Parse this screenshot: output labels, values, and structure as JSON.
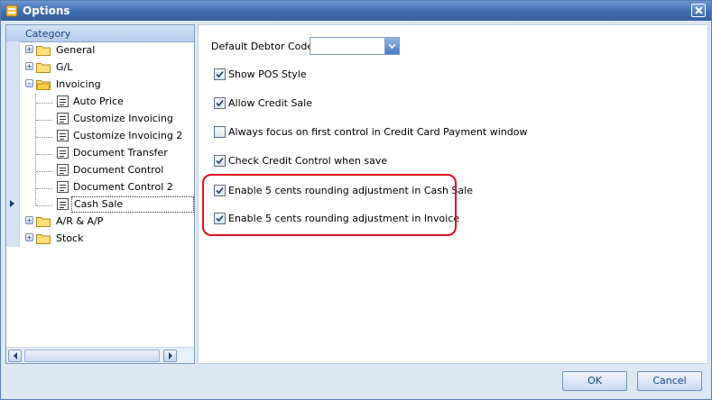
{
  "window": {
    "title": "Options"
  },
  "tree": {
    "header": "Category",
    "items": [
      {
        "label": "General",
        "type": "folder",
        "expander": "+"
      },
      {
        "label": "G/L",
        "type": "folder",
        "expander": "+"
      },
      {
        "label": "Invoicing",
        "type": "folder",
        "expander": "-"
      },
      {
        "label": "Auto Price",
        "type": "doc"
      },
      {
        "label": "Customize Invoicing",
        "type": "doc"
      },
      {
        "label": "Customize Invoicing 2",
        "type": "doc"
      },
      {
        "label": "Document Transfer",
        "type": "doc"
      },
      {
        "label": "Document Control",
        "type": "doc"
      },
      {
        "label": "Document Control 2",
        "type": "doc"
      },
      {
        "label": "Cash Sale",
        "type": "doc",
        "selected": true
      },
      {
        "label": "A/R & A/P",
        "type": "folder",
        "expander": "+"
      },
      {
        "label": "Stock",
        "type": "folder",
        "expander": "+"
      }
    ]
  },
  "settings": {
    "debtor_code_label": "Default Debtor Code:",
    "debtor_code_value": "",
    "checkboxes": [
      {
        "label": "Show POS Style",
        "checked": true
      },
      {
        "label": "Allow Credit Sale",
        "checked": true
      },
      {
        "label": "Always focus on first control in Credit Card Payment window",
        "checked": false
      },
      {
        "label": "Check Credit Control when save",
        "checked": true
      },
      {
        "label": "Enable 5 cents rounding adjustment in Cash Sale",
        "checked": true
      },
      {
        "label": "Enable 5 cents rounding adjustment in Invoice",
        "checked": true
      }
    ]
  },
  "buttons": {
    "ok": "OK",
    "cancel": "Cancel"
  },
  "colors": {
    "title_bar": "#3f6db0",
    "highlight": "#e0101e",
    "header_text": "#15428b"
  }
}
